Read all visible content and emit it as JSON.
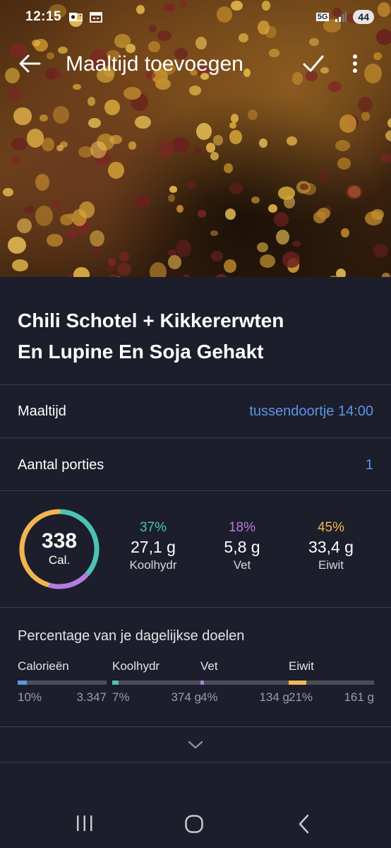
{
  "status_bar": {
    "time": "12:15",
    "network": "5G",
    "battery": "44"
  },
  "app_bar": {
    "title": "Maaltijd toevoegen"
  },
  "meal": {
    "title_line1": "Chili Schotel + Kikkererwten",
    "title_line2": "En Lupine En Soja Gehakt"
  },
  "rows": {
    "meal_label": "Maaltijd",
    "meal_value": "tussendoortje 14:00",
    "portions_label": "Aantal porties",
    "portions_value": "1"
  },
  "summary": {
    "calories": "338",
    "calories_unit": "Cal.",
    "macros": [
      {
        "pct": "37%",
        "amount": "27,1 g",
        "label": "Koolhydr",
        "color": "#4cc3b4",
        "fraction": 0.37
      },
      {
        "pct": "18%",
        "amount": "5,8 g",
        "label": "Vet",
        "color": "#b47ce0",
        "fraction": 0.18
      },
      {
        "pct": "45%",
        "amount": "33,4 g",
        "label": "Eiwit",
        "color": "#f1b550",
        "fraction": 0.45
      }
    ]
  },
  "goals": {
    "title": "Percentage van je dagelijkse doelen",
    "items": [
      {
        "name": "Calorieën",
        "pct": "10%",
        "target": "3.347",
        "color": "#5b95e6",
        "fraction": 0.1
      },
      {
        "name": "Koolhydr",
        "pct": "7%",
        "target": "374 g",
        "color": "#4cc3b4",
        "fraction": 0.07
      },
      {
        "name": "Vet",
        "pct": "4%",
        "target": "134 g",
        "color": "#b47ce0",
        "fraction": 0.04
      },
      {
        "name": "Eiwit",
        "pct": "21%",
        "target": "161 g",
        "color": "#f1b550",
        "fraction": 0.21
      }
    ]
  },
  "icons": [
    "back-arrow-icon",
    "check-icon",
    "more-vert-icon",
    "chevron-down-icon",
    "recents-icon",
    "home-icon",
    "back-nav-icon"
  ]
}
